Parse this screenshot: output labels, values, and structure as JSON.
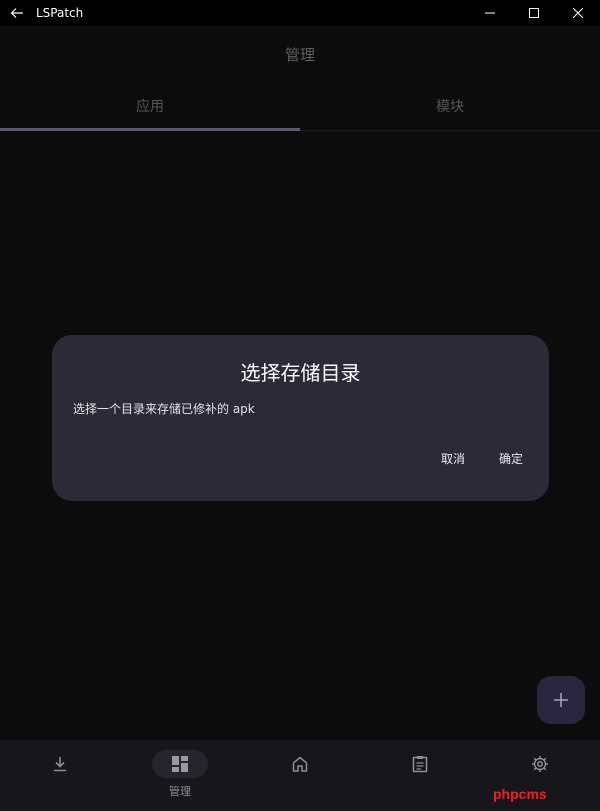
{
  "window": {
    "title": "LSPatch"
  },
  "appbar": {
    "title": "管理"
  },
  "tabs": [
    {
      "label": "应用",
      "active": true
    },
    {
      "label": "模块",
      "active": false
    }
  ],
  "dialog": {
    "title": "选择存储目录",
    "message": "选择一个目录来存储已修补的 apk",
    "cancel_label": "取消",
    "confirm_label": "确定"
  },
  "fab": {
    "icon": "plus-icon"
  },
  "bottom_nav": [
    {
      "icon": "download-icon",
      "label": "",
      "active": false
    },
    {
      "icon": "dashboard-icon",
      "label": "管理",
      "active": true
    },
    {
      "icon": "home-icon",
      "label": "",
      "active": false
    },
    {
      "icon": "clipboard-icon",
      "label": "",
      "active": false
    },
    {
      "icon": "gear-icon",
      "label": "",
      "active": false
    }
  ],
  "watermark": "phpcms",
  "colors": {
    "background": "#0c0c0d",
    "dialog": "#2d2a37",
    "fab": "#2b2640",
    "tab_indicator": "#5d5674",
    "watermark": "#ff1a1a"
  }
}
